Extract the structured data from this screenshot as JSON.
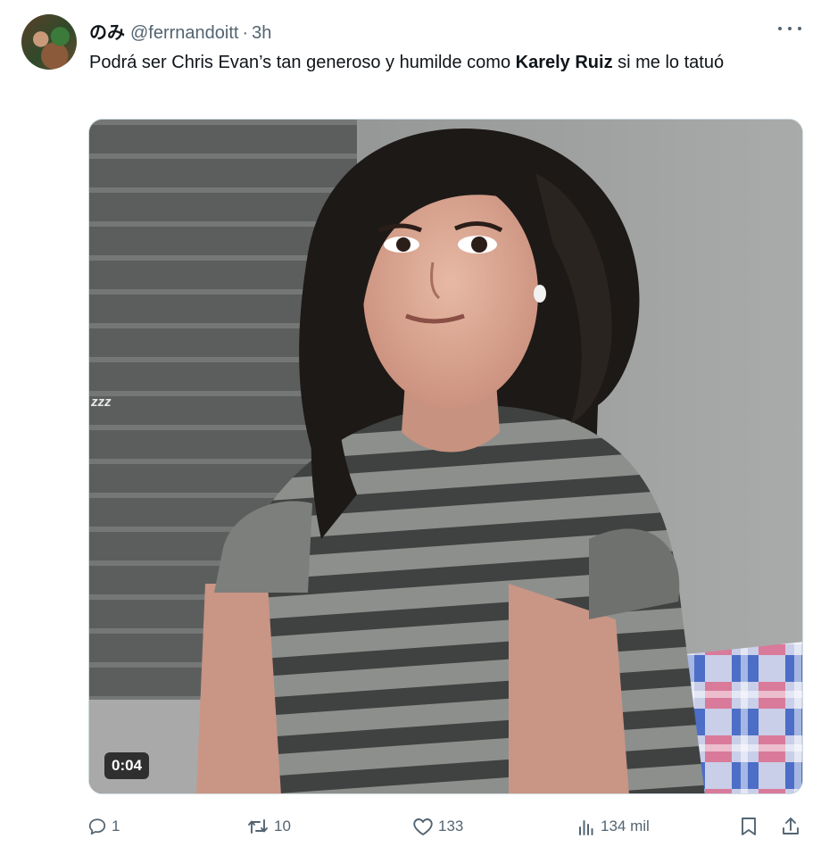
{
  "tweet": {
    "display_name": "のみ",
    "handle": "@ferrnandoitt",
    "separator": "·",
    "time": "3h",
    "text_before": "Podrá ser Chris Evan’s tan generoso y humilde como ",
    "text_bold": "Karely Ruiz",
    "text_after": " si me lo tatuó"
  },
  "media": {
    "duration": "0:04",
    "overlay_text": "zzz"
  },
  "actions": {
    "replies": "1",
    "reposts": "10",
    "likes": "133",
    "views": "134 mil"
  },
  "icons": {
    "reply": "reply-icon",
    "repost": "repost-icon",
    "like": "heart-icon",
    "views": "views-icon",
    "bookmark": "bookmark-icon",
    "share": "share-icon",
    "more": "more-icon"
  },
  "colors": {
    "text": "#0f1419",
    "secondary": "#536471"
  }
}
